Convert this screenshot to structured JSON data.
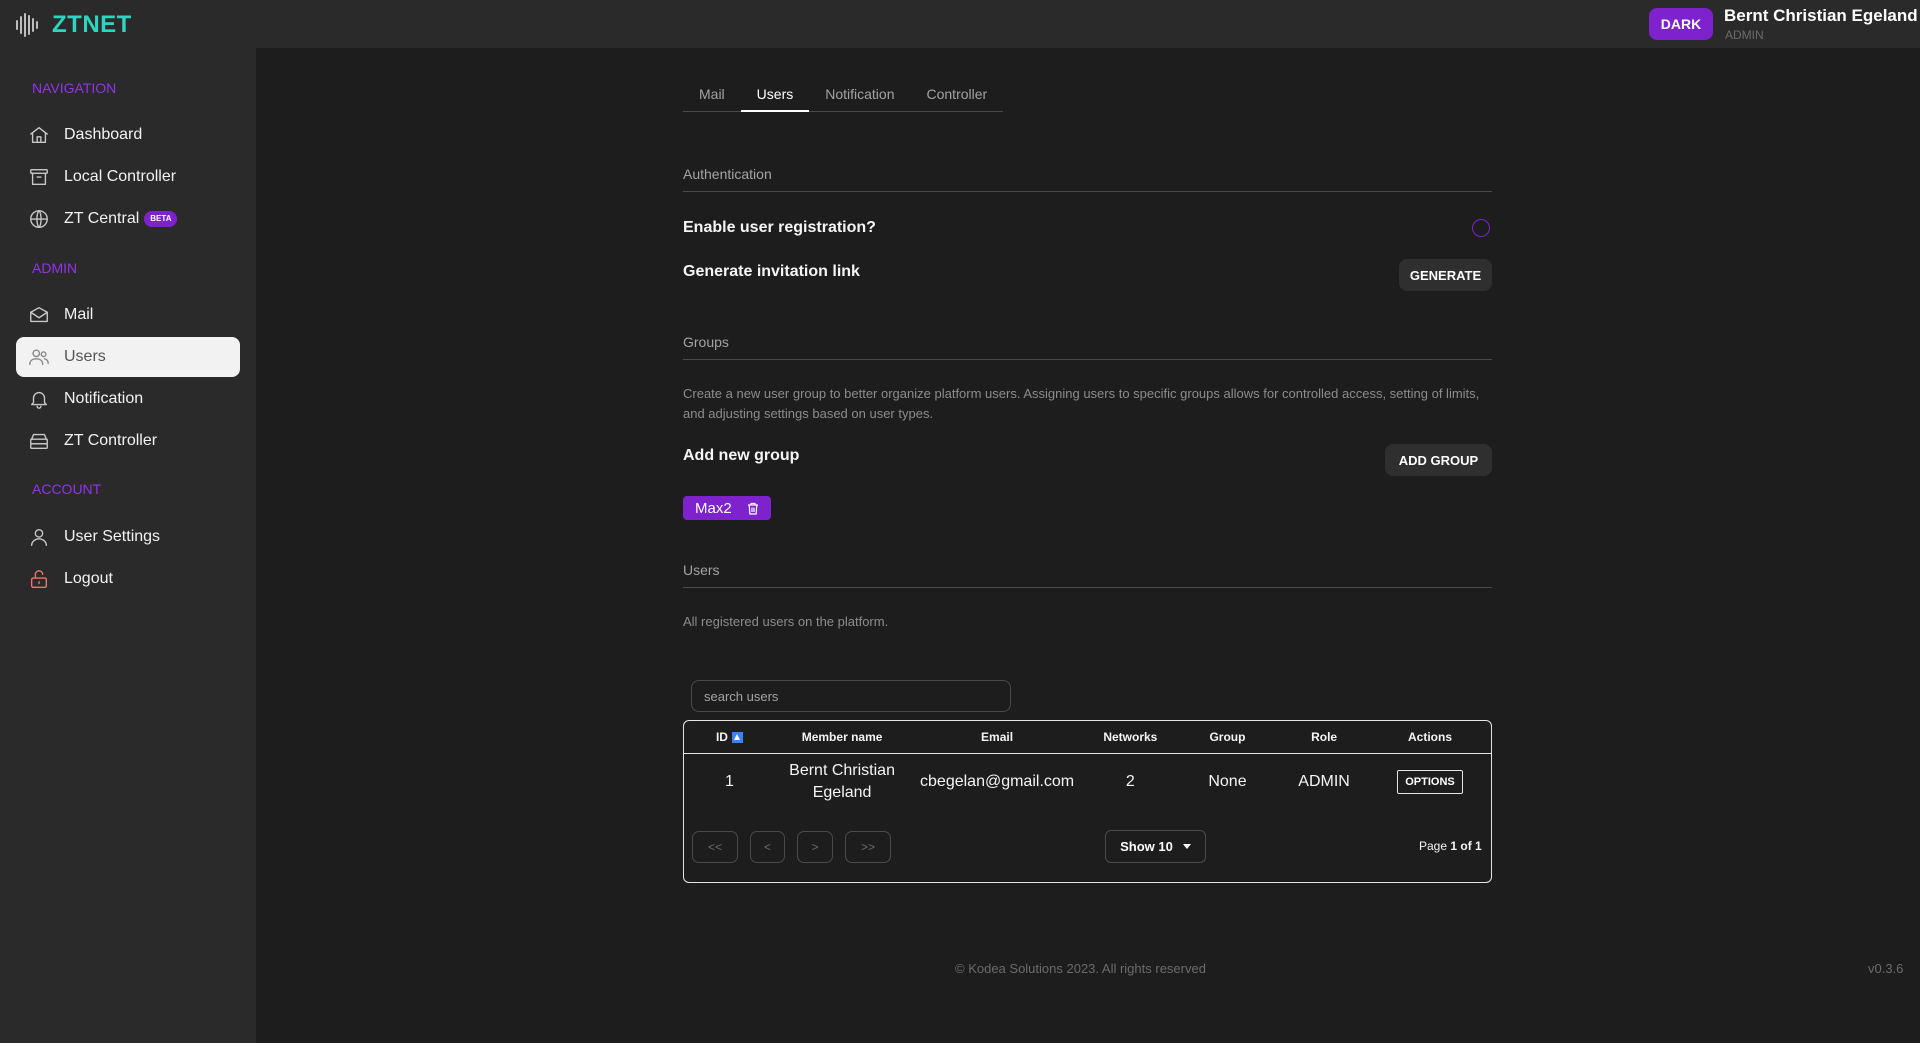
{
  "app": {
    "name": "ZTNET"
  },
  "header": {
    "theme_button": "DARK",
    "user_name": "Bernt Christian Egeland",
    "user_role": "ADMIN"
  },
  "sidebar": {
    "sections": {
      "navigation": "NAVIGATION",
      "admin": "ADMIN",
      "account": "ACCOUNT"
    },
    "navigation_items": [
      {
        "label": "Dashboard",
        "icon": "home-icon"
      },
      {
        "label": "Local Controller",
        "icon": "archive-icon"
      },
      {
        "label": "ZT Central",
        "icon": "globe-icon",
        "badge": "BETA"
      }
    ],
    "admin_items": [
      {
        "label": "Mail",
        "icon": "mail-icon"
      },
      {
        "label": "Users",
        "icon": "users-icon",
        "active": true
      },
      {
        "label": "Notification",
        "icon": "bell-icon"
      },
      {
        "label": "ZT Controller",
        "icon": "server-icon"
      }
    ],
    "account_items": [
      {
        "label": "User Settings",
        "icon": "user-icon"
      },
      {
        "label": "Logout",
        "icon": "lock-open-icon"
      }
    ]
  },
  "tabs": [
    {
      "label": "Mail"
    },
    {
      "label": "Users",
      "active": true
    },
    {
      "label": "Notification"
    },
    {
      "label": "Controller"
    }
  ],
  "authentication": {
    "title": "Authentication",
    "enable_registration_label": "Enable user registration?",
    "enable_registration_checked": false,
    "invitation_label": "Generate invitation link",
    "generate_button": "GENERATE"
  },
  "groups": {
    "title": "Groups",
    "description": "Create a new user group to better organize platform users. Assigning users to specific groups allows for controlled access, setting of limits, and adjusting settings based on user types.",
    "add_label": "Add new group",
    "add_button": "ADD GROUP",
    "items": [
      {
        "name": "Max2"
      }
    ]
  },
  "users": {
    "title": "Users",
    "description": "All registered users on the platform.",
    "search_placeholder": "search users",
    "columns": [
      "ID",
      "Member name",
      "Email",
      "Networks",
      "Group",
      "Role",
      "Actions"
    ],
    "rows": [
      {
        "id": "1",
        "name": "Bernt Christian Egeland",
        "email": "cbegelan@gmail.com",
        "networks": "2",
        "group": "None",
        "role": "ADMIN",
        "action": "OPTIONS"
      }
    ],
    "pagination": {
      "first": "<<",
      "prev": "<",
      "next": ">",
      "last": ">>",
      "page_size": "Show 10",
      "page_prefix": "Page",
      "page_current": "1 of 1"
    }
  },
  "footer": {
    "copyright": "© Kodea Solutions 2023. All rights reserved",
    "version": "v0.3.6"
  },
  "colors": {
    "accent": "#7e22ce",
    "brand": "#2dd4bf",
    "background": "#1d1d1d",
    "panel": "#2a2a2a"
  }
}
